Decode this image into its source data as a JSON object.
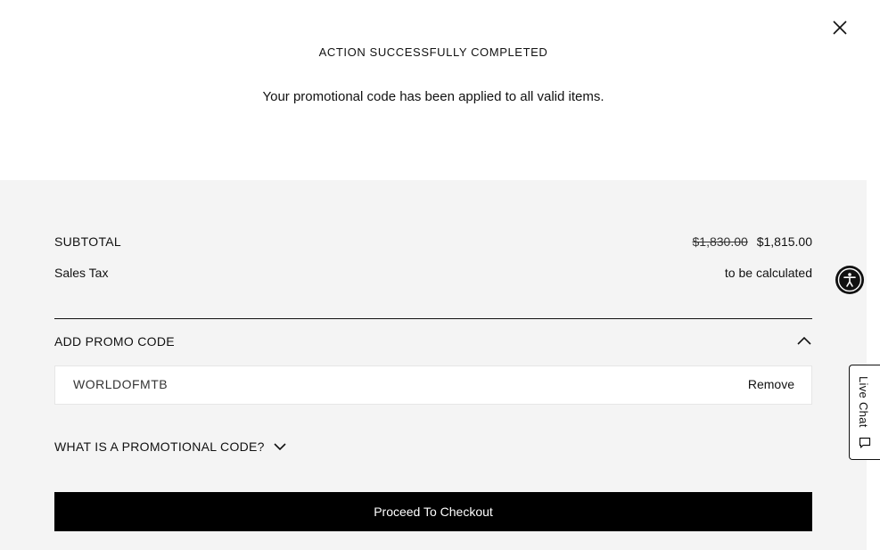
{
  "notice": {
    "title": "ACTION SUCCESSFULLY COMPLETED",
    "message": "Your promotional code has been applied to all valid items.",
    "close_icon": "close-icon"
  },
  "summary": {
    "subtotal_label": "SUBTOTAL",
    "subtotal_original": "$1,830.00",
    "subtotal_discounted": "$1,815.00",
    "tax_label": "Sales Tax",
    "tax_value": "to be calculated"
  },
  "promo": {
    "header": "ADD PROMO CODE",
    "code": "WORLDOFMTB",
    "remove_label": "Remove",
    "what_is_label": "WHAT IS A PROMOTIONAL CODE?"
  },
  "checkout": {
    "button_label": "Proceed To Checkout"
  },
  "widgets": {
    "live_chat_label": "Live Chat",
    "accessibility_icon": "accessibility-icon",
    "chat_icon": "chat-bubble-icon"
  },
  "colors": {
    "panel_bg": "#f4f4f4",
    "button_bg": "#000000",
    "text": "#111111"
  }
}
